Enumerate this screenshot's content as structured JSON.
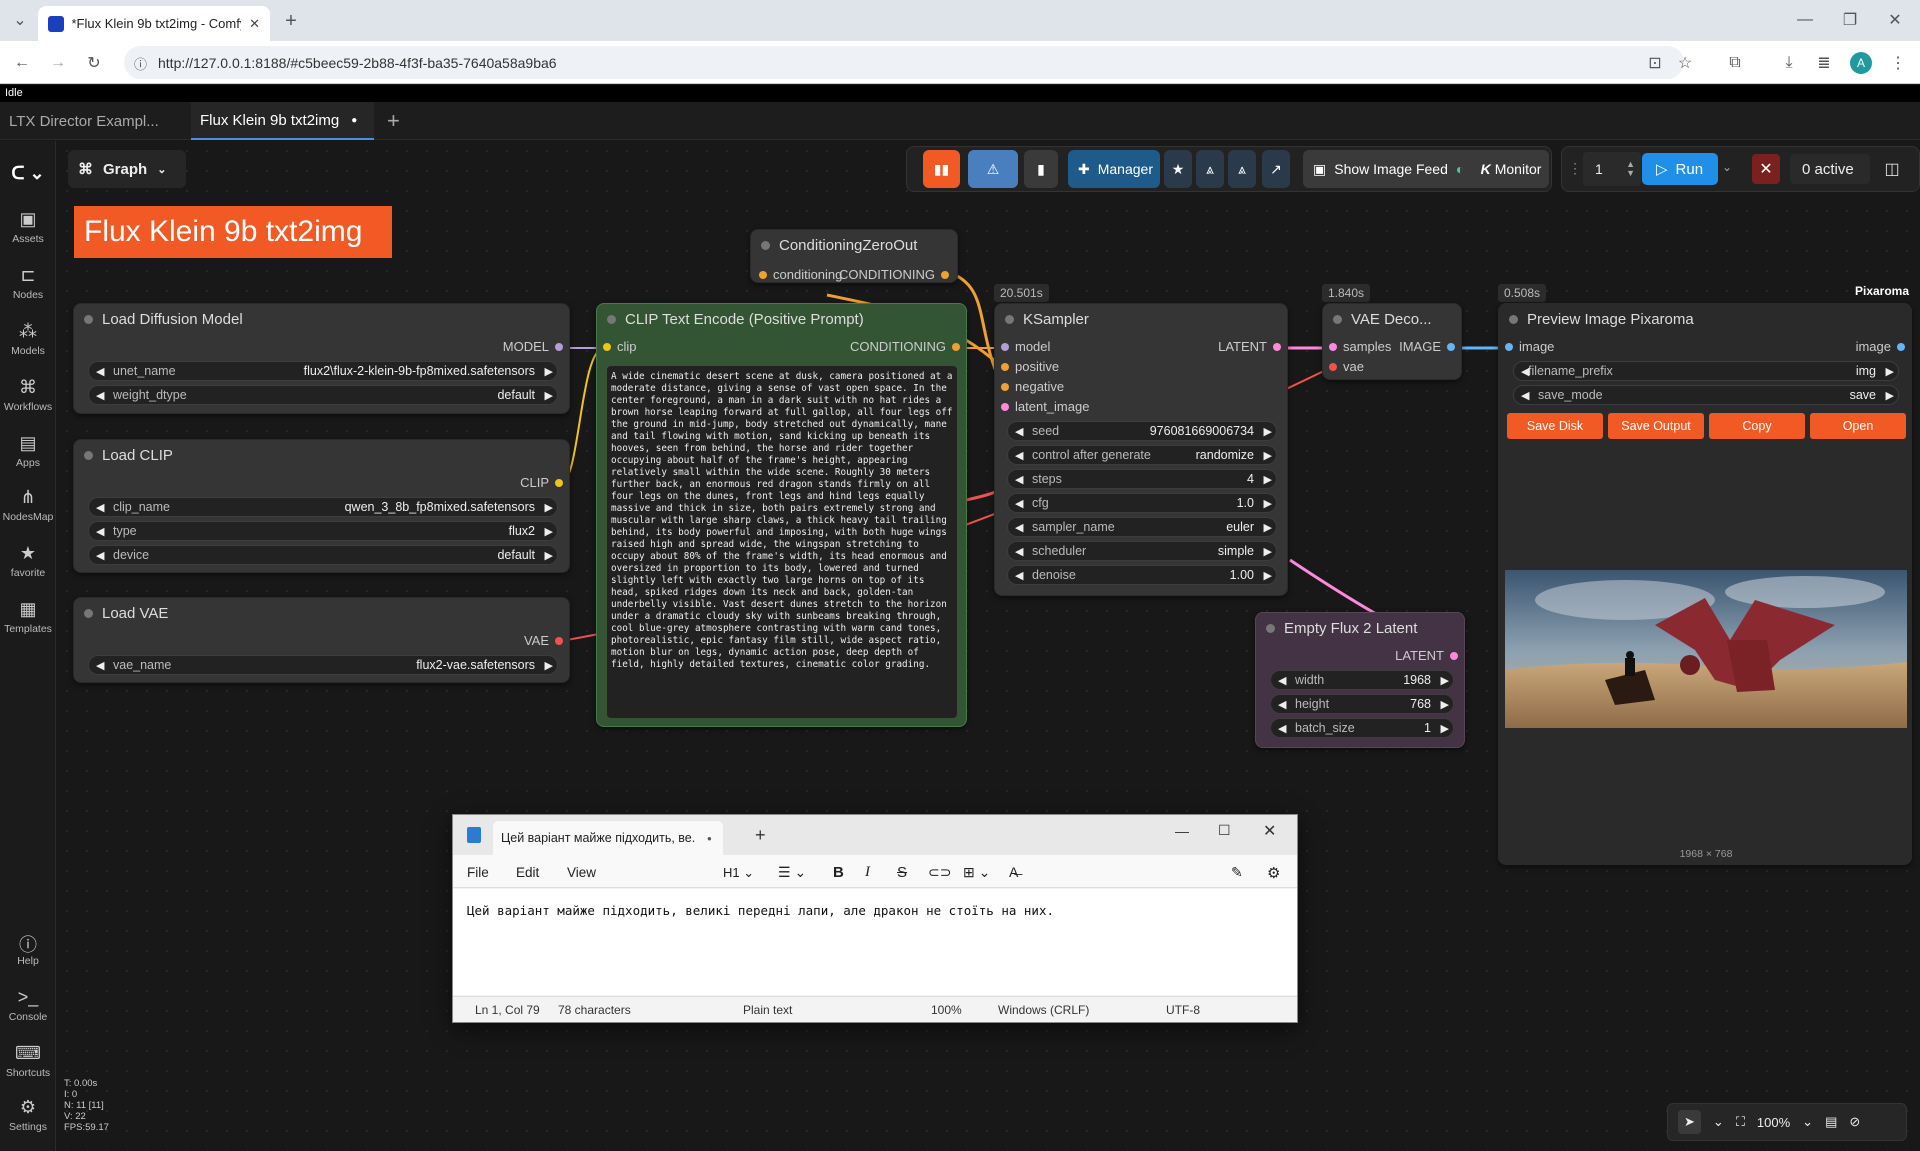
{
  "browser": {
    "tab_title": "*Flux Klein 9b txt2img - Comfy",
    "url": "http://127.0.0.1:8188/#c5beec59-2b88-4f3f-ba35-7640a58a9ba6",
    "avatar": "A"
  },
  "app": {
    "status": "Idle",
    "tabs": [
      {
        "label": "LTX Director Exampl..."
      },
      {
        "label": "Flux Klein 9b txt2img"
      }
    ],
    "graph_label": "Graph",
    "title_banner": "Flux Klein 9b txt2img",
    "sidebar": [
      {
        "label": "Assets",
        "icon": "assets-icon"
      },
      {
        "label": "Nodes",
        "icon": "nodes-icon"
      },
      {
        "label": "Models",
        "icon": "models-icon"
      },
      {
        "label": "Workflows",
        "icon": "workflows-icon"
      },
      {
        "label": "Apps",
        "icon": "apps-icon"
      },
      {
        "label": "NodesMap",
        "icon": "nodesmap-icon"
      },
      {
        "label": "favorite",
        "icon": "star-icon"
      },
      {
        "label": "Templates",
        "icon": "templates-icon"
      },
      {
        "label": "Help",
        "icon": "help-icon"
      },
      {
        "label": "Console",
        "icon": "console-icon"
      },
      {
        "label": "Shortcuts",
        "icon": "keyboard-icon"
      },
      {
        "label": "Settings",
        "icon": "gear-icon"
      }
    ],
    "stats": {
      "t": "T: 0.00s",
      "i": "I: 0",
      "n": "N: 11 [11]",
      "v": "V: 22",
      "fps": "FPS:59.17"
    },
    "toolbar": {
      "manager": "Manager",
      "show_feed": "Show Image Feed",
      "monitor": "Monitor",
      "queue_count": "1",
      "run": "Run",
      "active": "0 active"
    },
    "zoom": "100%",
    "pixaroma_label": "Pixaroma"
  },
  "nodes": {
    "conditioning_zero": {
      "title": "ConditioningZeroOut",
      "in": "conditioning",
      "out": "CONDITIONING"
    },
    "load_diffusion": {
      "title": "Load Diffusion Model",
      "out": "MODEL",
      "w1_label": "unet_name",
      "w1_value": "flux2\\flux-2-klein-9b-fp8mixed.safetensors",
      "w2_label": "weight_dtype",
      "w2_value": "default"
    },
    "load_clip": {
      "title": "Load CLIP",
      "out": "CLIP",
      "w1_label": "clip_name",
      "w1_value": "qwen_3_8b_fp8mixed.safetensors",
      "w2_label": "type",
      "w2_value": "flux2",
      "w3_label": "device",
      "w3_value": "default"
    },
    "load_vae": {
      "title": "Load VAE",
      "out": "VAE",
      "w1_label": "vae_name",
      "w1_value": "flux2-vae.safetensors"
    },
    "clip_encode": {
      "title": "CLIP Text Encode (Positive Prompt)",
      "in": "clip",
      "out": "CONDITIONING",
      "prompt": "A wide cinematic desert scene at dusk, camera positioned at a moderate distance, giving a sense of vast open space. In the center foreground, a man in a dark suit with no hat rides a brown horse leaping forward at full gallop, all four legs off the ground in mid-jump, body stretched out dynamically, mane and tail flowing with motion, sand kicking up beneath its hooves, seen from behind, the horse and rider together occupying about half of the frame's height, appearing relatively small within the wide scene. Roughly 30 meters further back, an enormous red dragon stands firmly on all four legs on the dunes, front legs and hind legs equally massive and thick in size, both pairs extremely strong and muscular with large sharp claws, a thick heavy tail trailing behind, its body powerful and imposing, with both huge wings raised high and spread wide, the wingspan stretching to occupy about 80% of the frame's width, its head enormous and oversized in proportion to its body, lowered and turned slightly left with exactly two large horns on top of its head, spiked ridges down its neck and back, golden-tan underbelly visible. Vast desert dunes stretch to the horizon under a dramatic cloudy sky with sunbeams breaking through, cool blue-grey atmosphere contrasting with warm cand tones, photorealistic, epic fantasy film still, wide aspect ratio, motion blur on legs, dynamic action pose, deep depth of field, highly detailed textures, cinematic color grading."
    },
    "ksampler": {
      "title": "KSampler",
      "timing": "20.501s",
      "out": "LATENT",
      "inputs": [
        "model",
        "positive",
        "negative",
        "latent_image"
      ],
      "widgets": [
        {
          "label": "seed",
          "value": "976081669006734"
        },
        {
          "label": "control after generate",
          "value": "randomize"
        },
        {
          "label": "steps",
          "value": "4"
        },
        {
          "label": "cfg",
          "value": "1.0"
        },
        {
          "label": "sampler_name",
          "value": "euler"
        },
        {
          "label": "scheduler",
          "value": "simple"
        },
        {
          "label": "denoise",
          "value": "1.00"
        }
      ]
    },
    "vae_decode": {
      "title": "VAE Deco...",
      "timing": "1.840s",
      "in1": "samples",
      "in2": "vae",
      "out": "IMAGE"
    },
    "empty_latent": {
      "title": "Empty Flux 2 Latent",
      "out": "LATENT",
      "w1_label": "width",
      "w1_value": "1968",
      "w2_label": "height",
      "w2_value": "768",
      "w3_label": "batch_size",
      "w3_value": "1"
    },
    "preview": {
      "title": "Preview Image Pixaroma",
      "timing": "0.508s",
      "in": "image",
      "out": "image",
      "w1_label": "filename_prefix",
      "w1_value": "img",
      "w2_label": "save_mode",
      "w2_value": "save",
      "buttons": [
        "Save Disk",
        "Save Output",
        "Copy",
        "Open"
      ],
      "dims": "1968 × 768"
    }
  },
  "notepad": {
    "tab_title": "Цей варіант майже підходить, ве.",
    "menu": [
      "File",
      "Edit",
      "View"
    ],
    "heading": "H1",
    "content": "Цей варіант майже підходить, великі передні лапи, але дракон не стоїть на них.",
    "status": {
      "pos": "Ln 1, Col 79",
      "chars": "78 characters",
      "format": "Plain text",
      "zoom": "100%",
      "eol": "Windows (CRLF)",
      "enc": "UTF-8"
    }
  },
  "colors": {
    "accent": "#f15a24",
    "run_blue": "#1f8fe8",
    "clip_node": "#335533",
    "latent_node": "#443344"
  }
}
